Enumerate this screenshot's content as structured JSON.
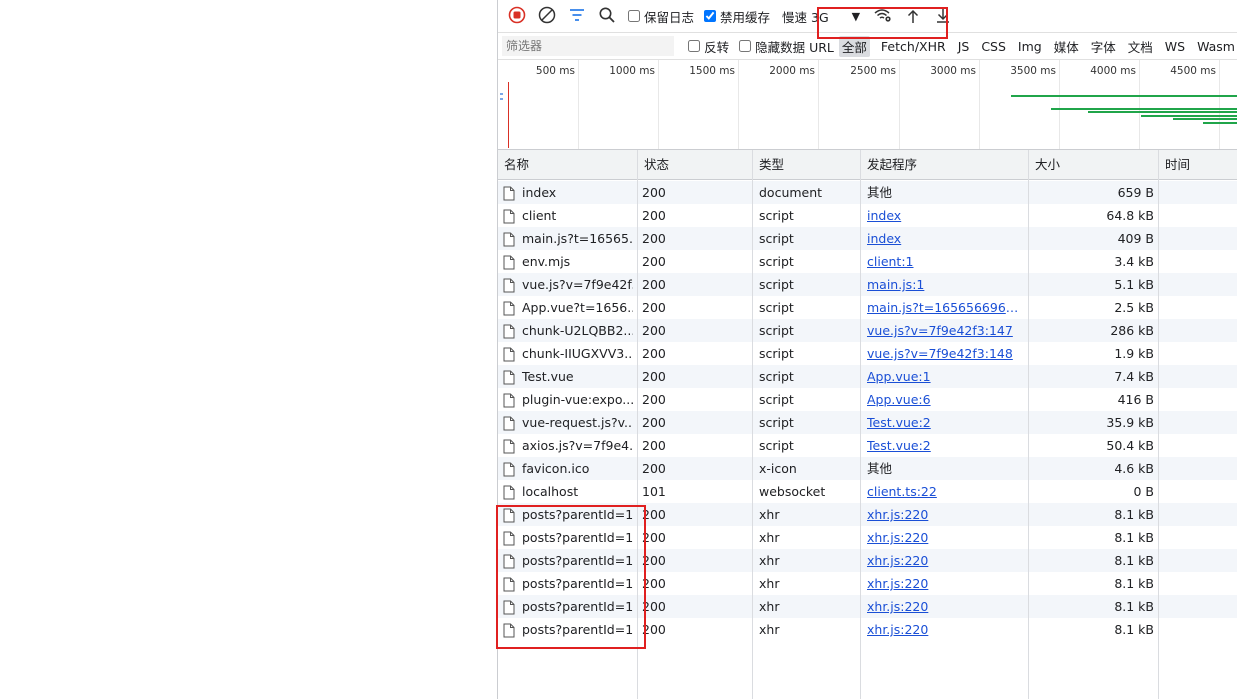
{
  "toolbar": {
    "preserve_log": {
      "label": "保留日志",
      "checked": false
    },
    "disable_cache": {
      "label": "禁用缓存",
      "checked": true
    },
    "throttle": "慢速 3G"
  },
  "filterbar": {
    "placeholder": "筛选器",
    "invert": {
      "label": "反转",
      "checked": false
    },
    "hide_data_urls": {
      "label": "隐藏数据 URL",
      "checked": false
    },
    "types": [
      "全部",
      "Fetch/XHR",
      "JS",
      "CSS",
      "Img",
      "媒体",
      "字体",
      "文档",
      "WS",
      "Wasm"
    ],
    "active_type": "全部"
  },
  "overview": {
    "ticks": [
      "500 ms",
      "1000 ms",
      "1500 ms",
      "2000 ms",
      "2500 ms",
      "3000 ms",
      "3500 ms",
      "4000 ms",
      "4500 ms"
    ]
  },
  "table": {
    "headers": {
      "name": "名称",
      "status": "状态",
      "type": "类型",
      "initiator": "发起程序",
      "size": "大小",
      "time": "时间"
    },
    "rows": [
      {
        "name": "index",
        "status": "200",
        "type": "document",
        "initiator": "其他",
        "link": false,
        "size": "659 B"
      },
      {
        "name": "client",
        "status": "200",
        "type": "script",
        "initiator": "index",
        "link": true,
        "size": "64.8 kB"
      },
      {
        "name": "main.js?t=16565...",
        "status": "200",
        "type": "script",
        "initiator": "index",
        "link": true,
        "size": "409 B"
      },
      {
        "name": "env.mjs",
        "status": "200",
        "type": "script",
        "initiator": "client:1",
        "link": true,
        "size": "3.4 kB"
      },
      {
        "name": "vue.js?v=7f9e42f3",
        "status": "200",
        "type": "script",
        "initiator": "main.js:1",
        "link": true,
        "size": "5.1 kB"
      },
      {
        "name": "App.vue?t=1656...",
        "status": "200",
        "type": "script",
        "initiator": "main.js?t=165656696057...",
        "link": true,
        "size": "2.5 kB"
      },
      {
        "name": "chunk-U2LQBB2...",
        "status": "200",
        "type": "script",
        "initiator": "vue.js?v=7f9e42f3:147",
        "link": true,
        "size": "286 kB"
      },
      {
        "name": "chunk-IIUGXVV3...",
        "status": "200",
        "type": "script",
        "initiator": "vue.js?v=7f9e42f3:148",
        "link": true,
        "size": "1.9 kB"
      },
      {
        "name": "Test.vue",
        "status": "200",
        "type": "script",
        "initiator": "App.vue:1",
        "link": true,
        "size": "7.4 kB"
      },
      {
        "name": "plugin-vue:expo...",
        "status": "200",
        "type": "script",
        "initiator": "App.vue:6",
        "link": true,
        "size": "416 B"
      },
      {
        "name": "vue-request.js?v...",
        "status": "200",
        "type": "script",
        "initiator": "Test.vue:2",
        "link": true,
        "size": "35.9 kB"
      },
      {
        "name": "axios.js?v=7f9e4...",
        "status": "200",
        "type": "script",
        "initiator": "Test.vue:2",
        "link": true,
        "size": "50.4 kB"
      },
      {
        "name": "favicon.ico",
        "status": "200",
        "type": "x-icon",
        "initiator": "其他",
        "link": false,
        "size": "4.6 kB"
      },
      {
        "name": "localhost",
        "status": "101",
        "type": "websocket",
        "initiator": "client.ts:22",
        "link": true,
        "size": "0 B"
      },
      {
        "name": "posts?parentId=1",
        "status": "200",
        "type": "xhr",
        "initiator": "xhr.js:220",
        "link": true,
        "size": "8.1 kB"
      },
      {
        "name": "posts?parentId=1",
        "status": "200",
        "type": "xhr",
        "initiator": "xhr.js:220",
        "link": true,
        "size": "8.1 kB"
      },
      {
        "name": "posts?parentId=1",
        "status": "200",
        "type": "xhr",
        "initiator": "xhr.js:220",
        "link": true,
        "size": "8.1 kB"
      },
      {
        "name": "posts?parentId=1",
        "status": "200",
        "type": "xhr",
        "initiator": "xhr.js:220",
        "link": true,
        "size": "8.1 kB"
      },
      {
        "name": "posts?parentId=1",
        "status": "200",
        "type": "xhr",
        "initiator": "xhr.js:220",
        "link": true,
        "size": "8.1 kB"
      },
      {
        "name": "posts?parentId=1",
        "status": "200",
        "type": "xhr",
        "initiator": "xhr.js:220",
        "link": true,
        "size": "8.1 kB"
      }
    ]
  },
  "colors": {
    "record": "#d93025",
    "link": "#1a4fd6",
    "waterfall": "#20a54a",
    "highlight": "#e02020"
  }
}
